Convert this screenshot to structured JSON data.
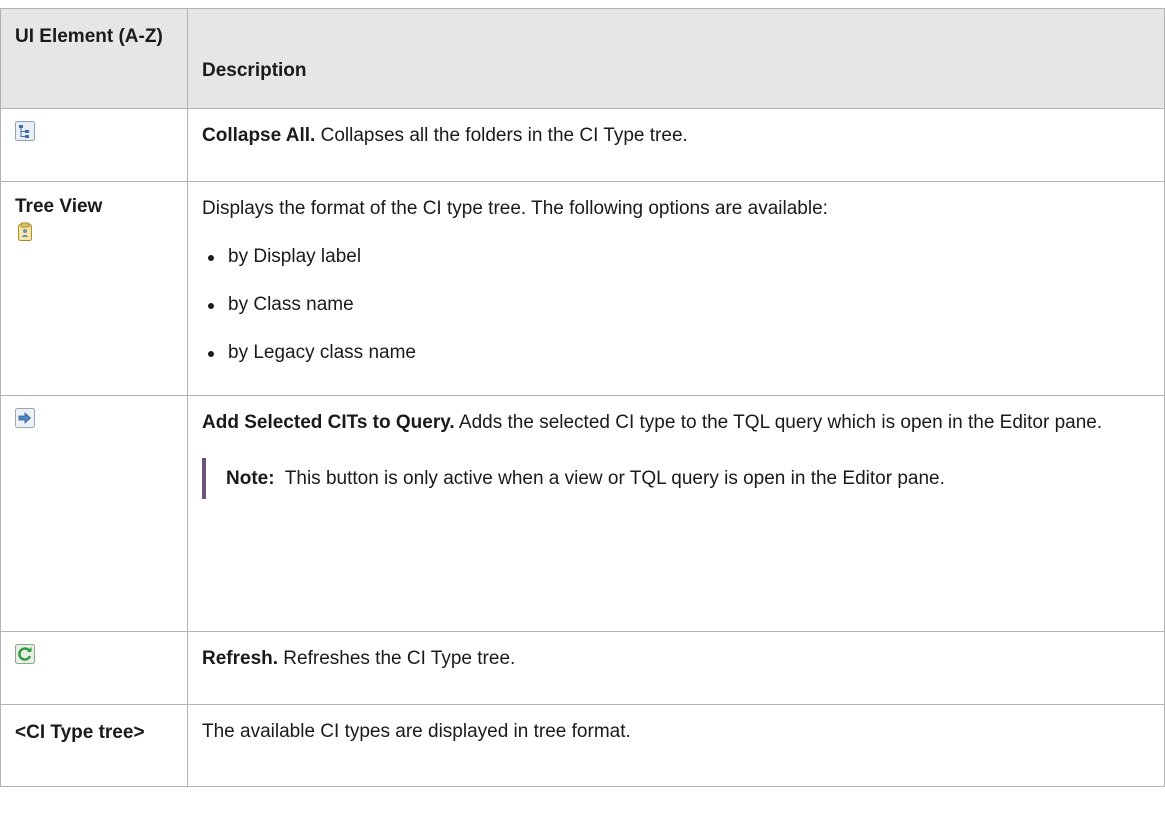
{
  "table": {
    "header": {
      "col1": "UI Element (A-Z)",
      "col2": "Description"
    },
    "rows": {
      "collapse": {
        "icon": "collapse-all-icon",
        "title": "Collapse All.",
        "text": " Collapses all the folders in the CI Type tree."
      },
      "tree_view": {
        "label": "Tree View",
        "icon": "tree-view-icon",
        "text": "Displays the format of the CI type tree. The following options are available:",
        "options": [
          "by Display label",
          "by Class name",
          "by Legacy class name"
        ]
      },
      "add_selected": {
        "icon": "add-to-query-arrow-icon",
        "title": "Add Selected CITs to Query.",
        "text": " Adds the selected CI type to the TQL query which is open in the Editor pane.",
        "note_label": "Note:",
        "note_text": "  This button is only active when a view or TQL query is open in the Editor pane."
      },
      "refresh": {
        "icon": "refresh-icon",
        "title": "Refresh.",
        "text": " Refreshes the CI Type tree."
      },
      "ci_type_tree": {
        "label": "<CI Type tree>",
        "text": "The available CI types are displayed in tree format."
      }
    }
  },
  "colors": {
    "header_bg": "#e6e6e6",
    "border": "#b3b3b3",
    "note_bar": "#6a5578"
  }
}
